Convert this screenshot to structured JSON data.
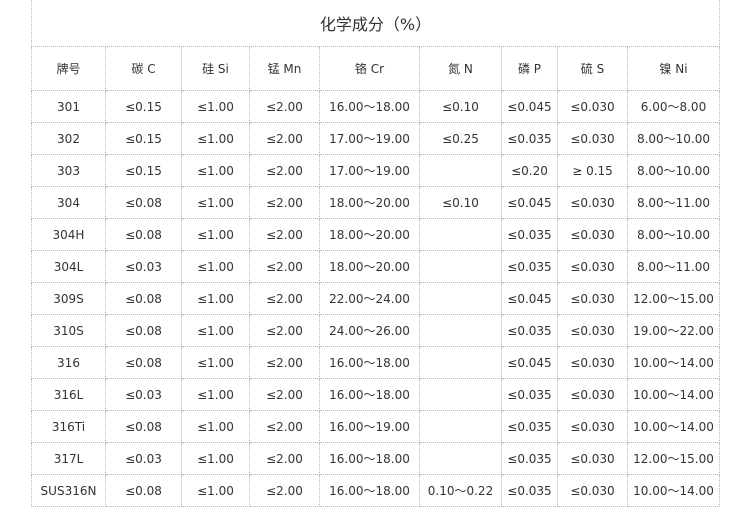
{
  "title": "化学成分（%）",
  "headers": [
    "牌号",
    "碳 C",
    "硅 Si",
    "锰 Mn",
    "铬 Cr",
    "氮 N",
    "磷 P",
    "硫 S",
    "镍 Ni"
  ],
  "rows": [
    [
      "301",
      "≤0.15",
      "≤1.00",
      "≤2.00",
      "16.00～18.00",
      "≤0.10",
      "≤0.045",
      "≤0.030",
      "6.00～8.00"
    ],
    [
      "302",
      "≤0.15",
      "≤1.00",
      "≤2.00",
      "17.00～19.00",
      "≤0.25",
      "≤0.035",
      "≤0.030",
      "8.00～10.00"
    ],
    [
      "303",
      "≤0.15",
      "≤1.00",
      "≤2.00",
      "17.00～19.00",
      "",
      "≤0.20",
      "≥ 0.15",
      "8.00～10.00"
    ],
    [
      "304",
      "≤0.08",
      "≤1.00",
      "≤2.00",
      "18.00～20.00",
      "≤0.10",
      "≤0.045",
      "≤0.030",
      "8.00～11.00"
    ],
    [
      "304H",
      "≤0.08",
      "≤1.00",
      "≤2.00",
      "18.00～20.00",
      "",
      "≤0.035",
      "≤0.030",
      "8.00～10.00"
    ],
    [
      "304L",
      "≤0.03",
      "≤1.00",
      "≤2.00",
      "18.00～20.00",
      "",
      "≤0.035",
      "≤0.030",
      "8.00～11.00"
    ],
    [
      "309S",
      "≤0.08",
      "≤1.00",
      "≤2.00",
      "22.00～24.00",
      "",
      "≤0.045",
      "≤0.030",
      "12.00～15.00"
    ],
    [
      "310S",
      "≤0.08",
      "≤1.00",
      "≤2.00",
      "24.00～26.00",
      "",
      "≤0.035",
      "≤0.030",
      "19.00～22.00"
    ],
    [
      "316",
      "≤0.08",
      "≤1.00",
      "≤2.00",
      "16.00～18.00",
      "",
      "≤0.045",
      "≤0.030",
      "10.00～14.00"
    ],
    [
      "316L",
      "≤0.03",
      "≤1.00",
      "≤2.00",
      "16.00～18.00",
      "",
      "≤0.035",
      "≤0.030",
      "10.00～14.00"
    ],
    [
      "316Ti",
      "≤0.08",
      "≤1.00",
      "≤2.00",
      "16.00～19.00",
      "",
      "≤0.035",
      "≤0.030",
      "10.00～14.00"
    ],
    [
      "317L",
      "≤0.03",
      "≤1.00",
      "≤2.00",
      "16.00～18.00",
      "",
      "≤0.035",
      "≤0.030",
      "12.00～15.00"
    ],
    [
      "SUS316N",
      "≤0.08",
      "≤1.00",
      "≤2.00",
      "16.00～18.00",
      "0.10～0.22",
      "≤0.035",
      "≤0.030",
      "10.00～14.00"
    ]
  ]
}
